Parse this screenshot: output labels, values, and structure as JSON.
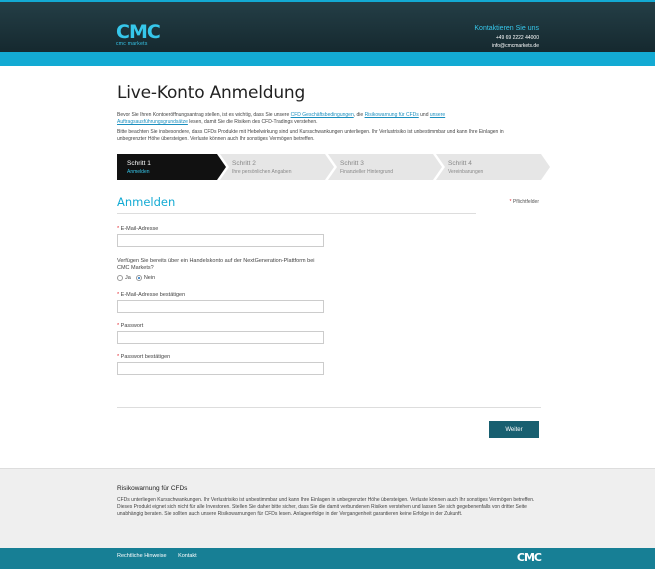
{
  "header": {
    "logo_mark": "CMC",
    "logo_sub": "cmc markets",
    "contact_title": "Kontaktieren Sie uns",
    "phone": "+49 69 2222 44000",
    "email": "info@cmcmarkets.de"
  },
  "page": {
    "title": "Live-Konto Anmeldung",
    "intro": {
      "t1": "Bevor Sie Ihren Kontoeröffnungsantrag stellen, ist es wichtig, dass Sie unsere ",
      "link1": "CFD Geschäftsbedingungen",
      "t2": ", die ",
      "link2": "Risikowarnung für CFDs",
      "t3": " und ",
      "link3": "unsere Auftragsausführungsgrundsätze",
      "t4": " lesen, damit Sie die Risiken des CFD-Tradings verstehen."
    },
    "intro2": "Bitte beachten Sie insbesondere, dass CFDs Produkte mit Hebelwirkung sind und Kursschwankungen unterliegen. Ihr Verlustrisiko ist unbestimmbar und kann Ihre Einlagen in unbegrenzter Höhe übersteigen. Verluste können auch Ihr sonstiges Vermögen betreffen."
  },
  "steps": [
    {
      "title": "Schritt 1",
      "sub": "Anmelden",
      "active": true
    },
    {
      "title": "Schritt 2",
      "sub": "Ihre persönlichen Angaben",
      "active": false
    },
    {
      "title": "Schritt 3",
      "sub": "Finanzieller Hintergrund",
      "active": false
    },
    {
      "title": "Schritt 4",
      "sub": "Vereinbarungen",
      "active": false
    }
  ],
  "form": {
    "section_title": "Anmelden",
    "required_note": "Pflichtfelder",
    "email_label": "E-Mail-Adresse",
    "email_value": "",
    "question": "Verfügen Sie bereits über ein Handelskonto auf der NextGeneration-Plattform bei CMC Markets?",
    "radio_yes": "Ja",
    "radio_no": "Nein",
    "radio_selected": "Nein",
    "email_confirm_label": "E-Mail-Adresse bestätigen",
    "password_label": "Passwort",
    "password_confirm_label": "Passwort bestätigen",
    "submit_label": "Weiter"
  },
  "risk": {
    "title": "Risikowarnung für CFDs",
    "text": "CFDs unterliegen Kursschwankungen. Ihr Verlustrisiko ist unbestimmbar und kann Ihre Einlagen in unbegrenzter Höhe übersteigen. Verluste können auch Ihr sonstiges Vermögen betreffen. Dieses Produkt eignet sich nicht für alle Investoren. Stellen Sie daher bitte sicher, dass Sie die damit verbundenen Risiken verstehen und lassen Sie sich gegebenenfalls von dritter Seite unabhängig beraten. Sie sollten auch unsere Risikowarnungen für CFDs lesen. Anlageerfolge in der Vergangenheit garantieren keine Erfolge in der Zukunft."
  },
  "footer": {
    "link1": "Rechtliche Hinweise",
    "link2": "Kontakt",
    "logo_mark": "CMC"
  },
  "colors": {
    "accent": "#13aad3",
    "header_dark": "#1b333a",
    "button": "#185f70",
    "footer": "#177f95",
    "required_star": "#e3262f"
  }
}
